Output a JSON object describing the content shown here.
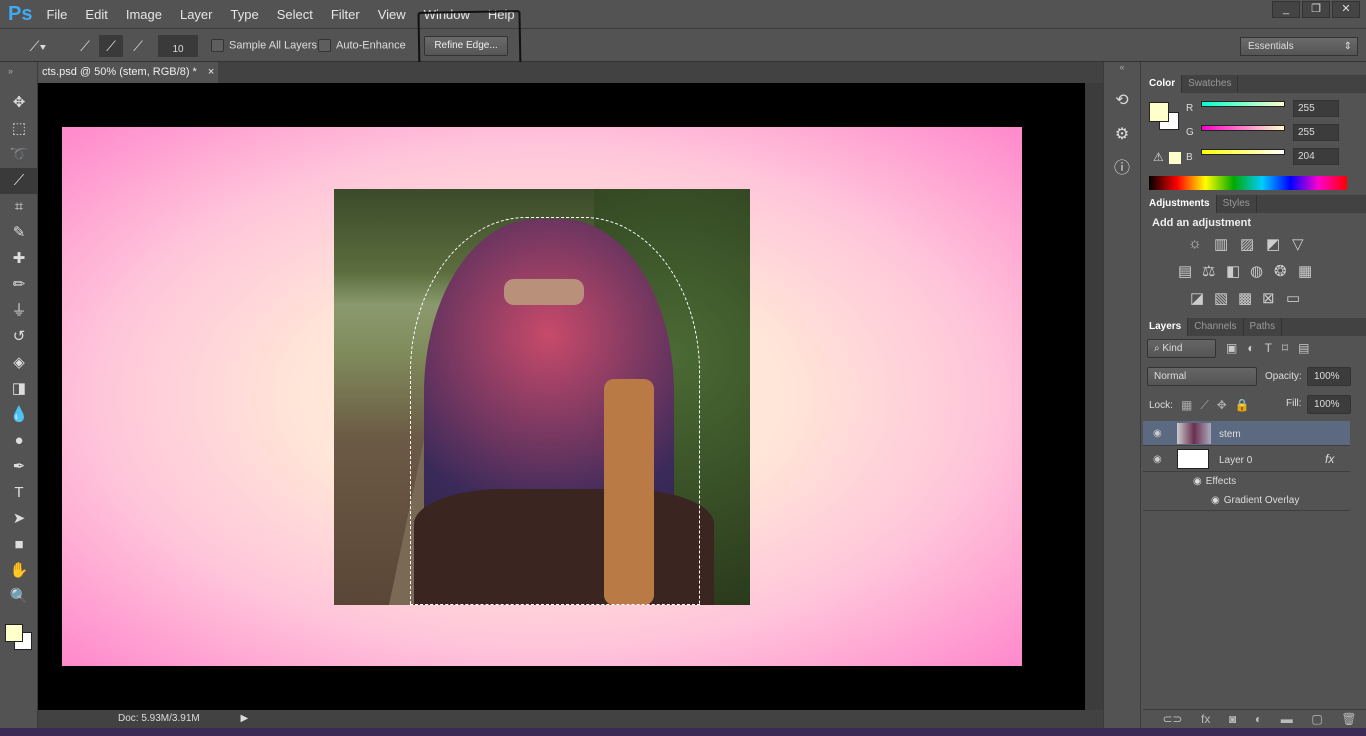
{
  "app": {
    "logo": "Ps",
    "menu": [
      "File",
      "Edit",
      "Image",
      "Layer",
      "Type",
      "Select",
      "Filter",
      "View",
      "Window",
      "Help"
    ],
    "window_controls": [
      "_",
      "❐",
      "✕"
    ]
  },
  "options": {
    "brush_size": "10",
    "sample_all_layers": "Sample All Layers",
    "sample_all_layers_checked": false,
    "auto_enhance": "Auto-Enhance",
    "auto_enhance_checked": false,
    "refine_edge": "Refine Edge...",
    "workspace": "Essentials"
  },
  "document": {
    "tab_title": "cts.psd @ 50% (stem, RGB/8) *",
    "close": "×",
    "doc_size": "Doc: 5.93M/3.91M"
  },
  "tools": [
    "move-tool",
    "rectangular-marquee-tool",
    "lasso-tool",
    "quick-selection-tool",
    "crop-tool",
    "eyedropper-tool",
    "spot-healing-tool",
    "brush-tool",
    "clone-stamp-tool",
    "history-brush-tool",
    "eraser-tool",
    "gradient-tool",
    "blur-tool",
    "dodge-tool",
    "pen-tool",
    "type-tool",
    "path-selection-tool",
    "rectangle-tool",
    "hand-tool",
    "zoom-tool"
  ],
  "colors": {
    "foreground": "#ffffcc",
    "background": "#ffffff",
    "gradient_edge": "#ff88cc",
    "gradient_center": "#ffebd6"
  },
  "color_panel": {
    "tabs": [
      "Color",
      "Swatches"
    ],
    "channels": [
      {
        "label": "R",
        "value": "255"
      },
      {
        "label": "G",
        "value": "255"
      },
      {
        "label": "B",
        "value": "204"
      }
    ]
  },
  "adjustments_panel": {
    "tabs": [
      "Adjustments",
      "Styles"
    ],
    "heading": "Add an adjustment"
  },
  "layers_panel": {
    "tabs": [
      "Layers",
      "Channels",
      "Paths"
    ],
    "filter": "Kind",
    "blend_mode": "Normal",
    "opacity_label": "Opacity:",
    "opacity": "100%",
    "lock_label": "Lock:",
    "fill_label": "Fill:",
    "fill": "100%",
    "layers": [
      {
        "name": "stem",
        "selected": true
      },
      {
        "name": "Layer 0",
        "fx": "fx",
        "effects_label": "Effects",
        "effect": "Gradient Overlay"
      }
    ]
  }
}
